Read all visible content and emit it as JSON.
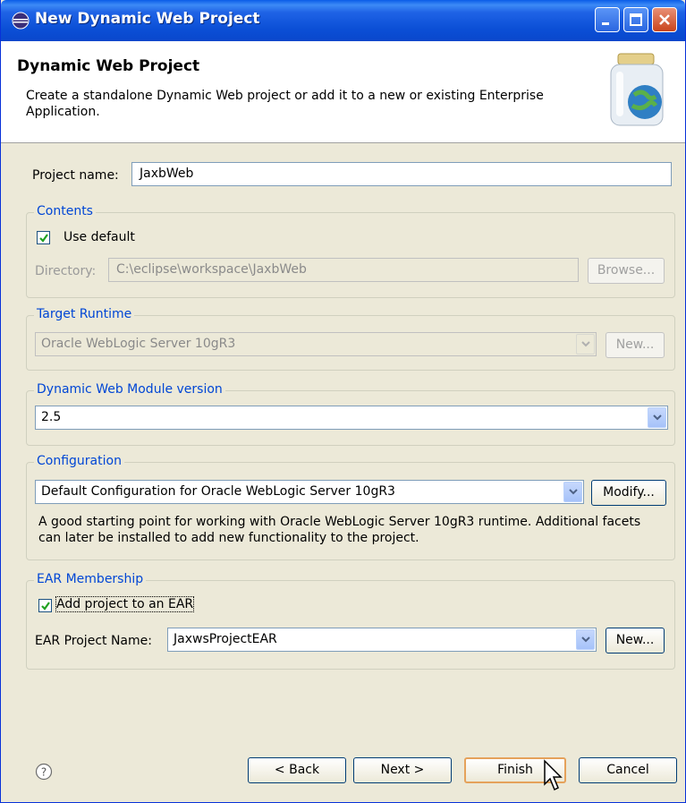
{
  "window": {
    "title": "New Dynamic Web Project"
  },
  "banner": {
    "title": "Dynamic Web Project",
    "description": "Create a standalone Dynamic Web project or add it to a new or existing Enterprise Application."
  },
  "project_name": {
    "label": "Project name:",
    "value": "JaxbWeb"
  },
  "contents": {
    "legend": "Contents",
    "use_default_label": "Use default",
    "use_default_checked": true,
    "directory_label": "Directory:",
    "directory_value": "C:\\eclipse\\workspace\\JaxbWeb",
    "browse_label": "Browse..."
  },
  "target_runtime": {
    "legend": "Target Runtime",
    "value": "Oracle WebLogic Server 10gR3",
    "new_label": "New..."
  },
  "module_version": {
    "legend": "Dynamic Web Module version",
    "value": "2.5"
  },
  "configuration": {
    "legend": "Configuration",
    "value": "Default Configuration for Oracle WebLogic Server 10gR3",
    "modify_label": "Modify...",
    "description": "A good starting point for working with Oracle WebLogic Server 10gR3 runtime. Additional facets can later be installed to add new functionality to the project."
  },
  "ear": {
    "legend": "EAR Membership",
    "add_label": "Add project to an EAR",
    "add_checked": true,
    "project_name_label": "EAR Project Name:",
    "project_name_value": "JaxwsProjectEAR",
    "new_label": "New..."
  },
  "footer": {
    "back_label": "< Back",
    "next_label": "Next >",
    "finish_label": "Finish",
    "cancel_label": "Cancel"
  },
  "colors": {
    "title_bar": "#0b4fd6",
    "dialog_bg": "#ece9d8",
    "group_legend": "#0046d5"
  },
  "icons": [
    "eclipse-app-icon",
    "minimize-icon",
    "maximize-icon",
    "close-icon",
    "web-project-jar-icon",
    "checkmark-icon",
    "chevron-down-icon",
    "help-icon",
    "mouse-cursor-icon"
  ]
}
